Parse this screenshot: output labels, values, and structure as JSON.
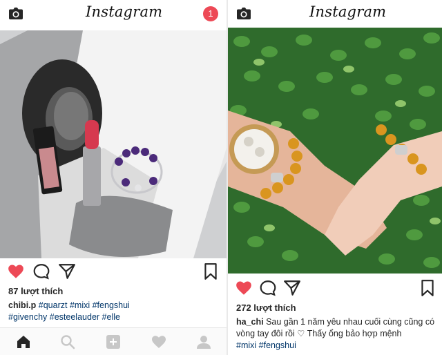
{
  "app": {
    "title": "Instagram"
  },
  "header": {
    "notification_count": "1"
  },
  "posts": [
    {
      "likes": "87 lượt thích",
      "username": "chibi.p",
      "caption_lines": [
        {
          "hashtags": [
            "#quarzt",
            "#mixi",
            "#fengshui"
          ]
        },
        {
          "hashtags": [
            "#givenchy",
            "#esteelauder",
            "#elle"
          ]
        }
      ]
    },
    {
      "likes": "272 lượt thích",
      "username": "ha_chi",
      "caption_text": "Sau gần 1 năm yêu nhau cuối cùng cũng có vòng tay đôi rồi ♡ Thấy ổng bảo hợp mệnh",
      "hashtags": [
        "#mixi",
        "#fengshui"
      ]
    }
  ],
  "icons": {
    "camera": "camera-icon",
    "heart_filled": "heart-filled-icon",
    "comment": "comment-icon",
    "share": "direct-share-icon",
    "bookmark": "bookmark-icon",
    "home": "home-icon",
    "search": "search-icon",
    "add": "add-post-icon",
    "activity": "activity-heart-icon",
    "profile": "profile-icon"
  },
  "colors": {
    "like_red": "#ed4956",
    "hashtag_blue": "#003569",
    "nav_inactive": "#c7c7c7"
  }
}
